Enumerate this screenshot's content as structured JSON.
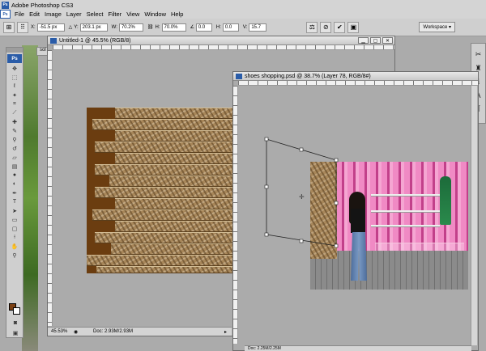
{
  "app": {
    "title": "Adobe Photoshop CS3",
    "logo": "Ps"
  },
  "menu": [
    "File",
    "Edit",
    "Image",
    "Layer",
    "Select",
    "Filter",
    "View",
    "Window",
    "Help"
  ],
  "options": {
    "x_label": "X:",
    "x_value": "-51.5 px",
    "y_label": "Y:",
    "y_value": "203.1 px",
    "w_label": "W:",
    "w_value": "70.2%",
    "h_label": "H:",
    "h_value": "70.0%",
    "angle_value": "0.0",
    "hskew_label": "H:",
    "hskew_value": "0.0",
    "vskew_label": "V:",
    "vskew_value": "15.7",
    "workspace_label": "Workspace"
  },
  "doc1": {
    "title": "Untitled-1 @ 45.5% (RGB/8)",
    "zoom": "45.53%",
    "doc_info": "Doc: 2.93M/2.93M"
  },
  "doc2": {
    "title": "shoes shopping.psd @ 38.7% (Layer 78, RGB/8#)",
    "doc_info": "Doc: 2.25M/2.25M"
  },
  "background_window": {
    "title": "sol"
  },
  "colors": {
    "brand": "#2a5ca8",
    "foreground": "#7a3f12",
    "background": "#ffffff"
  },
  "icons": {
    "tools": [
      "move-tool-icon",
      "marquee-tool-icon",
      "lasso-tool-icon",
      "magic-wand-icon",
      "crop-tool-icon",
      "slice-tool-icon",
      "healing-brush-icon",
      "brush-tool-icon",
      "clone-stamp-icon",
      "history-brush-icon",
      "eraser-tool-icon",
      "gradient-tool-icon",
      "blur-tool-icon",
      "dodge-tool-icon",
      "pen-tool-icon",
      "type-tool-icon",
      "path-selection-icon",
      "shape-tool-icon",
      "notes-tool-icon",
      "eyedropper-tool-icon",
      "hand-tool-icon",
      "zoom-tool-icon"
    ],
    "right_dock": [
      "navigator-icon",
      "histogram-icon",
      "info-icon",
      "character-icon",
      "paragraph-icon"
    ]
  }
}
